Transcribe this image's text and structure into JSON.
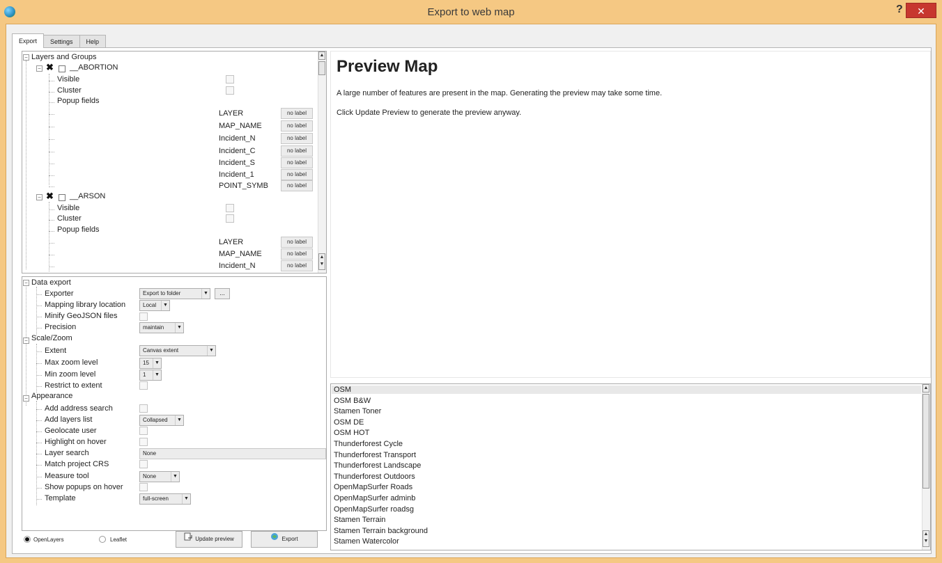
{
  "window": {
    "title": "Export to web map",
    "help": "?",
    "close": "✕"
  },
  "tabs": [
    "Export",
    "Settings",
    "Help"
  ],
  "tree": {
    "root": "Layers and Groups",
    "layers": [
      {
        "name": "__ABORTION",
        "props": [
          "Visible",
          "Cluster",
          "Popup fields"
        ],
        "fields": [
          "LAYER",
          "MAP_NAME",
          "Incident_N",
          "Incident_C",
          "Incident_S",
          "Incident_1",
          "POINT_SYMB"
        ]
      },
      {
        "name": "__ARSON",
        "props": [
          "Visible",
          "Cluster",
          "Popup fields"
        ],
        "fields": [
          "LAYER",
          "MAP_NAME",
          "Incident_N"
        ]
      }
    ],
    "field_value": "no label"
  },
  "options": {
    "data_export": {
      "header": "Data export",
      "exporter": {
        "label": "Exporter",
        "value": "Export to folder",
        "browse": "..."
      },
      "mapping": {
        "label": "Mapping library location",
        "value": "Local"
      },
      "minify": {
        "label": "Minify GeoJSON files"
      },
      "precision": {
        "label": "Precision",
        "value": "maintain"
      }
    },
    "scale_zoom": {
      "header": "Scale/Zoom",
      "extent": {
        "label": "Extent",
        "value": "Canvas extent"
      },
      "max_zoom": {
        "label": "Max zoom level",
        "value": "15"
      },
      "min_zoom": {
        "label": "Min zoom level",
        "value": "1"
      },
      "restrict": {
        "label": "Restrict to extent"
      }
    },
    "appearance": {
      "header": "Appearance",
      "address_search": {
        "label": "Add address search"
      },
      "layers_list": {
        "label": "Add layers list",
        "value": "Collapsed"
      },
      "geolocate": {
        "label": "Geolocate user"
      },
      "highlight": {
        "label": "Highlight on hover"
      },
      "layer_search": {
        "label": "Layer search",
        "value": "None"
      },
      "match_crs": {
        "label": "Match project CRS"
      },
      "measure": {
        "label": "Measure tool",
        "value": "None"
      },
      "popups_hover": {
        "label": "Show popups on hover"
      },
      "template": {
        "label": "Template",
        "value": "full-screen"
      }
    }
  },
  "bottom": {
    "openlayers": "OpenLayers",
    "leaflet": "Leaflet",
    "selected": "OpenLayers",
    "update_preview": "Update preview",
    "export": "Export"
  },
  "preview": {
    "title": "Preview Map",
    "line1": "A large number of features are present in the map. Generating the preview may take some time.",
    "line2": "Click Update Preview to generate the preview anyway."
  },
  "basemaps": [
    "OSM",
    "OSM B&W",
    "Stamen Toner",
    "OSM DE",
    "OSM HOT",
    "Thunderforest Cycle",
    "Thunderforest Transport",
    "Thunderforest Landscape",
    "Thunderforest Outdoors",
    "OpenMapSurfer Roads",
    "OpenMapSurfer adminb",
    "OpenMapSurfer roadsg",
    "Stamen Terrain",
    "Stamen Terrain background",
    "Stamen Watercolor"
  ],
  "colors": {
    "titlebar": "#f5c883",
    "close": "#c7372f"
  }
}
